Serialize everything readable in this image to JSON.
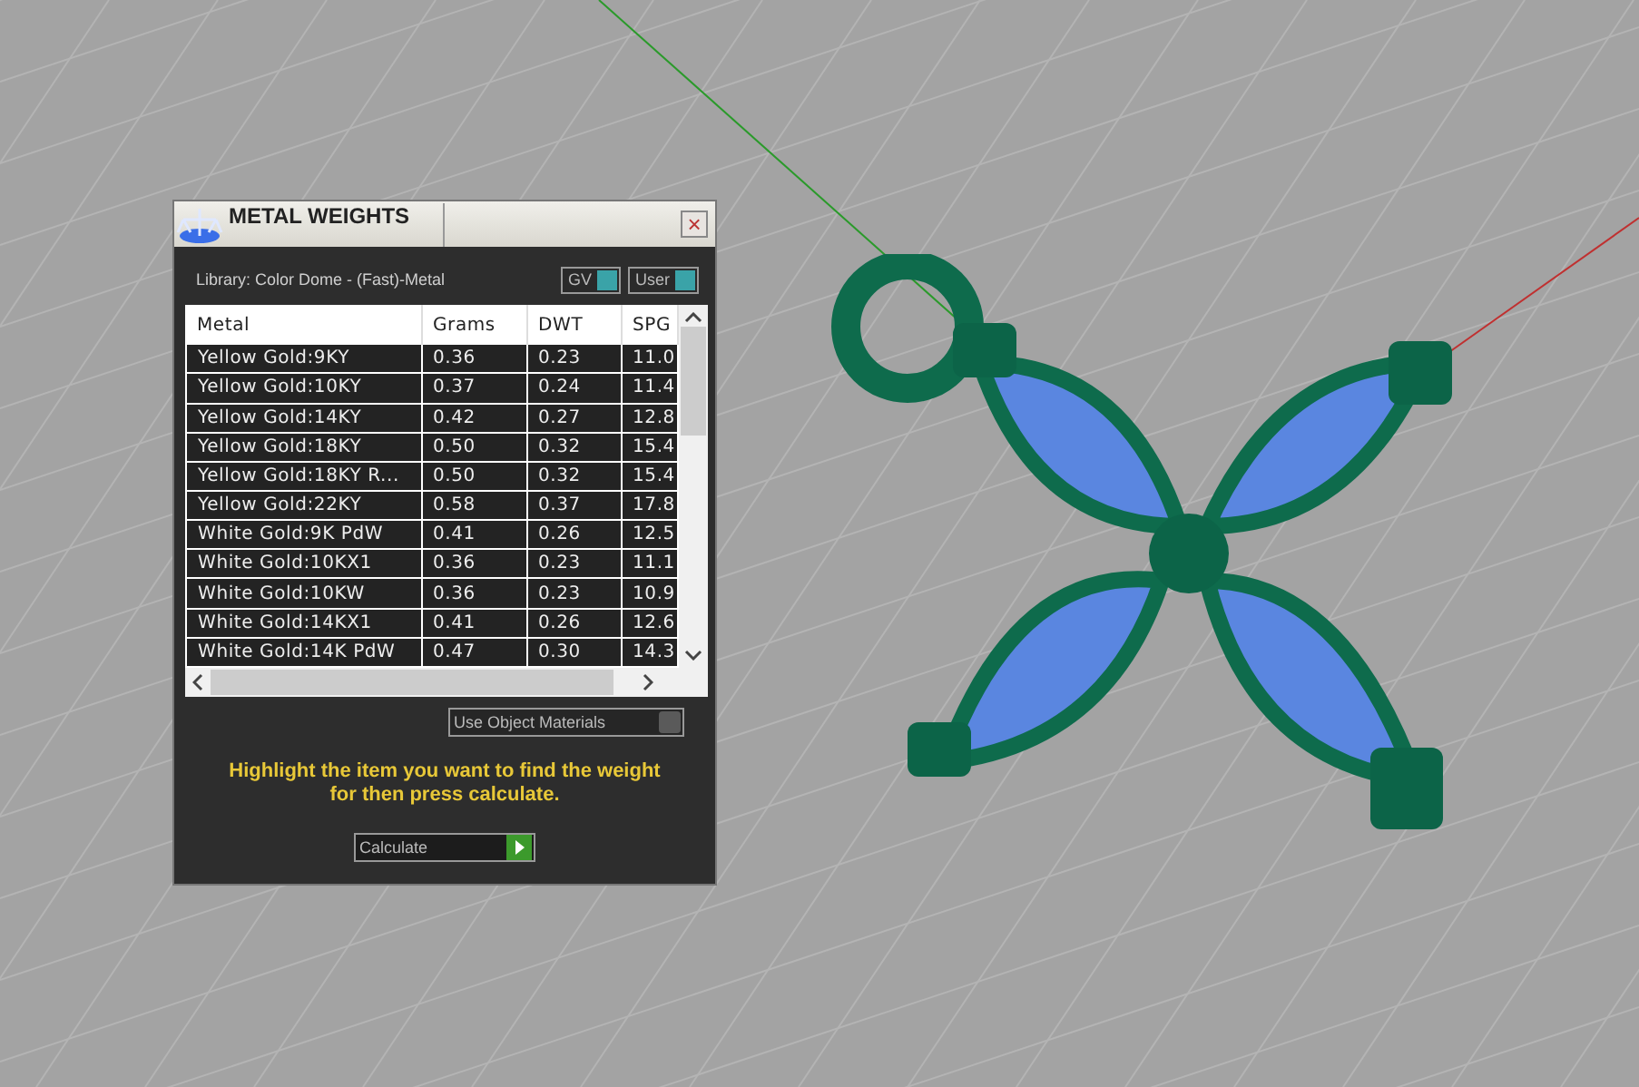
{
  "window": {
    "title": "METAL WEIGHTS",
    "close": "×"
  },
  "library": "Library: Color Dome - (Fast)-Metal",
  "toggles": [
    {
      "label": "GV",
      "on": true
    },
    {
      "label": "User",
      "on": true
    }
  ],
  "table": {
    "columns": [
      "Metal",
      "Grams",
      "DWT",
      "SPG"
    ],
    "rows": [
      [
        "Yellow Gold:9KY",
        "0.36",
        "0.23",
        "11.0"
      ],
      [
        "Yellow Gold:10KY",
        "0.37",
        "0.24",
        "11.4"
      ],
      [
        "Yellow Gold:14KY",
        "0.42",
        "0.27",
        "12.8"
      ],
      [
        "Yellow Gold:18KY",
        "0.50",
        "0.32",
        "15.4"
      ],
      [
        "Yellow Gold:18KY R...",
        "0.50",
        "0.32",
        "15.4"
      ],
      [
        "Yellow Gold:22KY",
        "0.58",
        "0.37",
        "17.8"
      ],
      [
        "White Gold:9K PdW",
        "0.41",
        "0.26",
        "12.5"
      ],
      [
        "White Gold:10KX1",
        "0.36",
        "0.23",
        "11.1"
      ],
      [
        "White Gold:10KW",
        "0.36",
        "0.23",
        "10.9"
      ],
      [
        "White Gold:14KX1",
        "0.41",
        "0.26",
        "12.6"
      ],
      [
        "White Gold:14K PdW",
        "0.47",
        "0.30",
        "14.3"
      ]
    ]
  },
  "use_object_materials": {
    "label": "Use Object Materials",
    "on": false
  },
  "hint": "Highlight the item you want to find the weight for then press calculate.",
  "calculate": {
    "label": "Calculate"
  }
}
